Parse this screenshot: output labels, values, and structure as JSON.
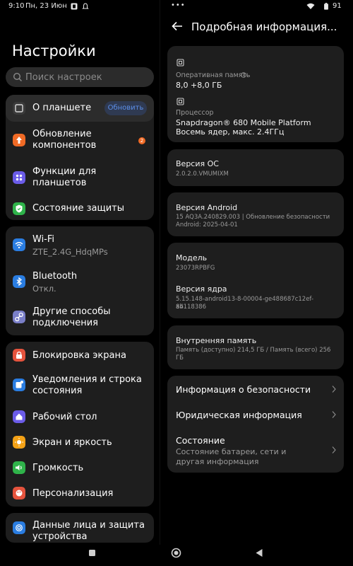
{
  "status_bar": {
    "time": "9:10",
    "date": "Пн, 23 Июн",
    "right_dots": "•••",
    "battery": "91"
  },
  "left": {
    "title": "Настройки",
    "search_placeholder": "Поиск настроек",
    "group1": [
      {
        "label": "О планшете",
        "icon": "tablet-icon",
        "button": "Обновить",
        "selected": true
      },
      {
        "label": "Обновление\nкомпонентов",
        "icon": "update-arrow-icon",
        "badge": "2"
      },
      {
        "label": "Функции для\nпланшетов",
        "icon": "grid-icon"
      },
      {
        "label": "Состояние защиты",
        "icon": "shield-icon"
      }
    ],
    "group2": [
      {
        "label": "Wi-Fi",
        "sub": "ZTE_2.4G_HdqMPs",
        "icon": "wifi-icon"
      },
      {
        "label": "Bluetooth",
        "sub": "Откл.",
        "icon": "bluetooth-icon"
      },
      {
        "label": "Другие способы\nподключения",
        "icon": "link-icon"
      }
    ],
    "group3": [
      {
        "label": "Блокировка экрана",
        "icon": "lock-icon"
      },
      {
        "label": "Уведомления и строка\nсостояния",
        "icon": "notification-icon"
      },
      {
        "label": "Рабочий стол",
        "icon": "home-icon"
      },
      {
        "label": "Экран и яркость",
        "icon": "sun-icon"
      },
      {
        "label": "Громкость",
        "icon": "volume-icon"
      },
      {
        "label": "Персонализация",
        "icon": "palette-icon"
      }
    ],
    "group4": [
      {
        "label": "Данные лица и защита\nустройства",
        "icon": "fingerprint-icon"
      }
    ]
  },
  "right": {
    "title": "Подробная информация...",
    "ram_label": "Оперативная память",
    "ram_value": "8,0 +8,0 ГБ",
    "cpu_label": "Процессор",
    "cpu_value1": "Snapdragon® 680 Mobile Platform",
    "cpu_value2": "Восемь ядер, макс. 2.4ГГц",
    "os_title": "Версия ОС",
    "os_value": "2.0.2.0.VMUMIXM",
    "android_title": "Версия Android",
    "android_value1": "15 AQ3A.240829.003 | Обновление безопасности",
    "android_value2": "Android: 2025-04-01",
    "model_title": "Модель",
    "model_value": "23073RPBFG",
    "kernel_title": "Версия ядра",
    "kernel_value1": "5.15.148-android13-8-00004-ge488687c12ef-ab118386",
    "kernel_value2": "84",
    "storage_title": "Внутренняя память",
    "storage_value1": "Память (доступно)   214,5 ГБ / Память (всего)   256",
    "storage_value2": "ГБ",
    "security_info": "Информация о безопасности",
    "legal_info": "Юридическая информация",
    "state_title": "Состояние",
    "state_desc": "Состояние батареи, сети и другая информация"
  },
  "colors": {
    "background": "#000000",
    "card": "#1e1e1e",
    "accent": "#5c8fe8"
  }
}
